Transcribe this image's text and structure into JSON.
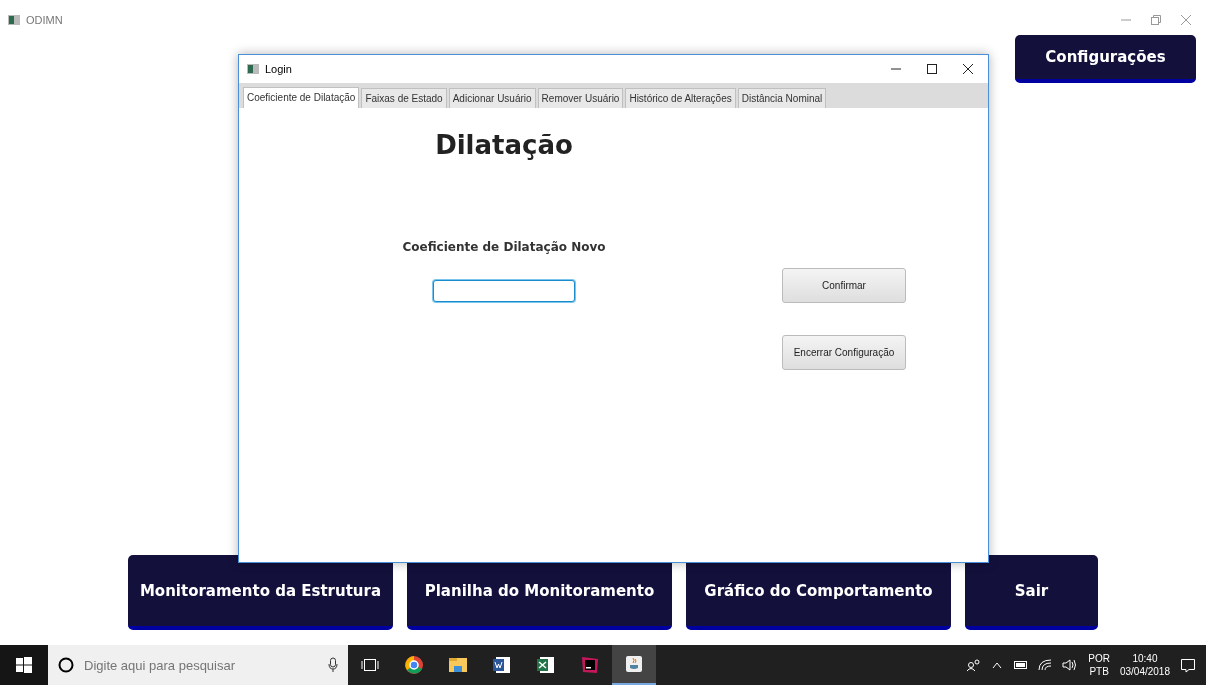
{
  "app": {
    "title": "ODIMN"
  },
  "settings_button": "Configurações",
  "nav_buttons": [
    "Monitoramento da Estrutura",
    "Planilha do Monitoramento",
    "Gráfico do Comportamento",
    "Sair"
  ],
  "dialog": {
    "title": "Login",
    "tabs": [
      {
        "label": "Coeficiente de Dilatação",
        "selected": true
      },
      {
        "label": "Faixas de Estado",
        "selected": false
      },
      {
        "label": "Adicionar Usuário",
        "selected": false
      },
      {
        "label": "Remover Usuário",
        "selected": false
      },
      {
        "label": "Histórico de Alterações",
        "selected": false
      },
      {
        "label": "Distância Nominal",
        "selected": false
      }
    ],
    "heading": "Dilatação",
    "field_label": "Coeficiente de Dilatação Novo",
    "field_focused": true,
    "buttons": [
      "Confirmar",
      "Encerrar Configuração"
    ]
  },
  "taskbar": {
    "search": {
      "placeholder": "Digite aqui para pesquisar"
    },
    "apps": [
      {
        "kind": "browser",
        "active": false
      },
      {
        "kind": "folder",
        "active": false
      },
      {
        "kind": "word",
        "active": false
      },
      {
        "kind": "excel",
        "active": false
      },
      {
        "kind": "ide",
        "active": false
      },
      {
        "kind": "java",
        "active": true
      }
    ],
    "language": "POR",
    "keyboard": "PTB",
    "time": "10:40",
    "date": "03/04/2018"
  }
}
